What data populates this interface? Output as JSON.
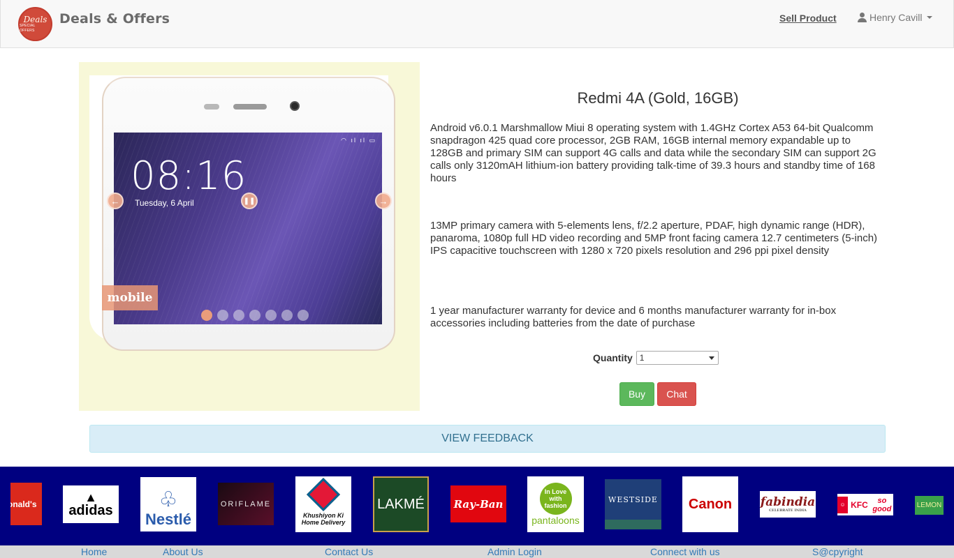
{
  "header": {
    "logo_line1": "Deals",
    "logo_line2": "SPECIAL OFFERS",
    "brand": "Deals & Offers",
    "sell_link": "Sell Product",
    "user_name": "Henry Cavill"
  },
  "gallery": {
    "clock": "08:16",
    "date": "Tuesday, 6 April",
    "category_tag": "mobile",
    "slide_count": 7,
    "active_slide": 1
  },
  "product": {
    "title": "Redmi 4A (Gold, 16GB)",
    "descriptions": [
      "Android v6.0.1 Marshmallow Miui 8 operating system with 1.4GHz Cortex A53 64-bit Qualcomm snapdragon 425 quad core processor, 2GB RAM, 16GB internal memory expandable up to 128GB and primary SIM can support 4G calls and data while the secondary SIM can support 2G calls only 3120mAH lithium-ion battery providing talk-time of 39.3 hours and standby time of 168 hours",
      "13MP primary camera with 5-elements lens, f/2.2 aperture, PDAF, high dynamic range (HDR), panaroma, 1080p full HD video recording and 5MP front facing camera 12.7 centimeters (5-inch) IPS capacitive touchscreen with 1280 x 720 pixels resolution and 296 ppi pixel density",
      "1 year manufacturer warranty for device and 6 months manufacturer warranty for in-box accessories including batteries from the date of purchase"
    ],
    "quantity_label": "Quantity",
    "quantity_value": "1",
    "buy_label": "Buy",
    "chat_label": "Chat",
    "feedback_label": "VIEW FEEDBACK"
  },
  "brands": [
    "McDonald's",
    "adidas",
    "Nestlé",
    "ORIFLAME",
    "Domino's Pizza",
    "LAKMÉ",
    "Ray-Ban",
    "pantaloons",
    "WESTSIDE",
    "Canon",
    "fabindia",
    "KFC so good",
    "LEMON"
  ],
  "brand_texts": {
    "mcd": "onald's",
    "adidas": "adidas",
    "nestle": "Nestlé",
    "oriflame": "ORIFLAME",
    "dominos": "Khushiyon Ki Home Delivery",
    "lakme": "LAKMÉ",
    "rayban": "Ray-Ban",
    "pantaloons_top": "In Love with fashion",
    "pantaloons": "pantaloons",
    "westside": "WESTSIDE",
    "canon": "Canon",
    "fabindia": "fabindia",
    "fabindia_sub": "CELEBRATE INDIA",
    "kfc": "KFC",
    "kfc_sub": "so good",
    "lemon": "LEMON"
  },
  "footer": {
    "links": [
      "Home",
      "About Us",
      "Contact Us",
      "Admin Login",
      "Connect with us",
      "S@cpyright"
    ]
  },
  "colors": {
    "navbar_bg": "#f8f8f8",
    "image_panel_bg": "#f8f8d8",
    "buy_green": "#5cb85c",
    "chat_red": "#d9534f",
    "feedback_bg": "#d9edf7",
    "brand_strip_bg": "#000080",
    "footer_link": "#337ab7"
  }
}
